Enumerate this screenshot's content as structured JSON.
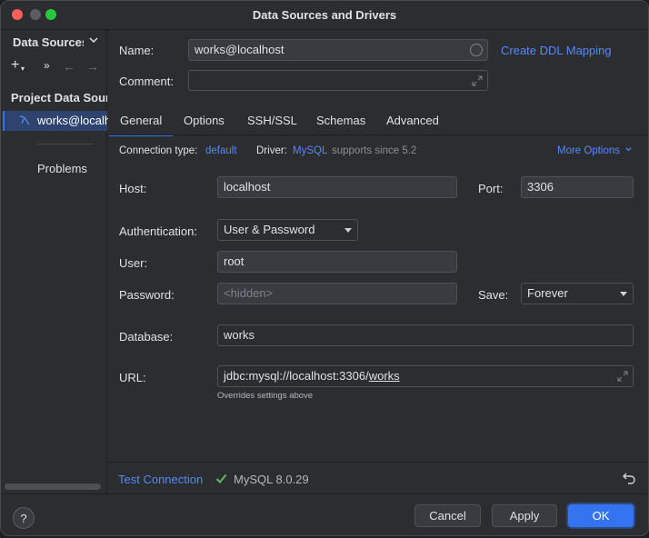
{
  "window": {
    "title": "Data Sources and Drivers"
  },
  "sidebar": {
    "header_title": "Data Sources",
    "toolbar": {
      "add": "+",
      "add_caret": "▾",
      "more": "»",
      "back": "←",
      "forward": "→"
    },
    "section_label": "Project Data Sources",
    "selected_item": "works@localhost",
    "problems_label": "Problems"
  },
  "form": {
    "name_label": "Name:",
    "name_value": "works@localhost",
    "create_ddl_link": "Create DDL Mapping",
    "comment_label": "Comment:",
    "comment_value": ""
  },
  "tabs": [
    "General",
    "Options",
    "SSH/SSL",
    "Schemas",
    "Advanced"
  ],
  "active_tab": "General",
  "general": {
    "connection_type_label": "Connection type:",
    "connection_type_value": "default",
    "driver_label": "Driver:",
    "driver_value": "MySQL",
    "driver_note": "supports since 5.2",
    "more_options": "More Options",
    "host_label": "Host:",
    "host_value": "localhost",
    "port_label": "Port:",
    "port_value": "3306",
    "auth_label": "Authentication:",
    "auth_value": "User & Password",
    "user_label": "User:",
    "user_value": "root",
    "password_label": "Password:",
    "password_placeholder": "<hidden>",
    "save_label": "Save:",
    "save_value": "Forever",
    "database_label": "Database:",
    "database_value": "works",
    "url_label": "URL:",
    "url_prefix": "jdbc:mysql://localhost:3306/",
    "url_db": "works",
    "url_hint": "Overrides settings above"
  },
  "footer": {
    "test_connection": "Test Connection",
    "status_text": "MySQL 8.0.29",
    "status_color": "#5fb865"
  },
  "buttons": {
    "help": "?",
    "cancel": "Cancel",
    "apply": "Apply",
    "ok": "OK"
  },
  "colors": {
    "accent": "#3574f0",
    "link": "#548af7",
    "background": "#2b2d30"
  }
}
